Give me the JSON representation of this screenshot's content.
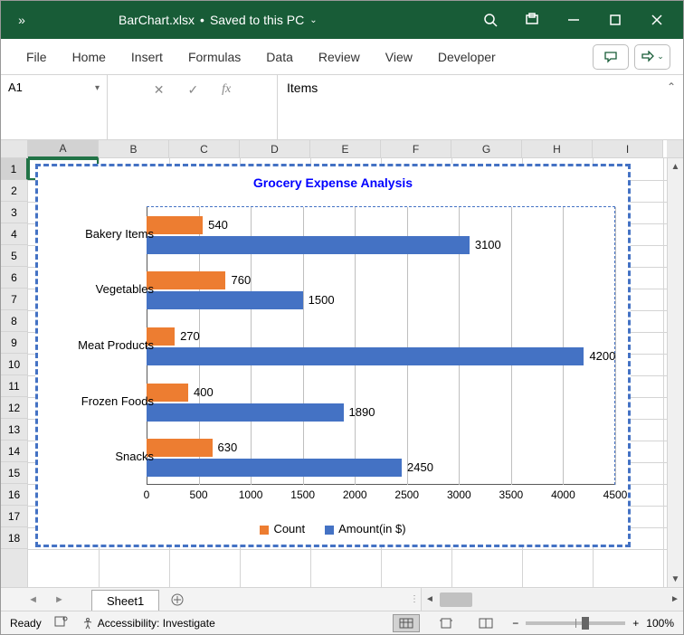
{
  "title": {
    "filename": "BarChart.xlsx",
    "save_status": "Saved to this PC"
  },
  "ribbon": {
    "tabs": [
      "File",
      "Home",
      "Insert",
      "Formulas",
      "Data",
      "Review",
      "View",
      "Developer"
    ]
  },
  "formula_bar": {
    "cell_ref": "A1",
    "formula_value": "Items"
  },
  "grid": {
    "columns": [
      "A",
      "B",
      "C",
      "D",
      "E",
      "F",
      "G",
      "H",
      "I"
    ],
    "active_col_index": 0,
    "rows": [
      1,
      2,
      3,
      4,
      5,
      6,
      7,
      8,
      9,
      10,
      11,
      12,
      13,
      14,
      15,
      16,
      17,
      18
    ],
    "active_row_index": 0
  },
  "sheet": {
    "name": "Sheet1"
  },
  "status": {
    "mode": "Ready",
    "accessibility": "Accessibility: Investigate",
    "zoom": "100%"
  },
  "chart_data": {
    "type": "bar",
    "title": "Grocery Expense Analysis",
    "categories": [
      "Bakery Items",
      "Vegetables",
      "Meat Products",
      "Frozen Foods",
      "Snacks"
    ],
    "series": [
      {
        "name": "Count",
        "color": "#ed7d31",
        "values": [
          540,
          760,
          270,
          400,
          630
        ]
      },
      {
        "name": "Amount(in $)",
        "color": "#4472c4",
        "values": [
          3100,
          1500,
          4200,
          1890,
          2450
        ]
      }
    ],
    "xlim": [
      0,
      4500
    ],
    "xticks": [
      0,
      500,
      1000,
      1500,
      2000,
      2500,
      3000,
      3500,
      4000,
      4500
    ]
  }
}
